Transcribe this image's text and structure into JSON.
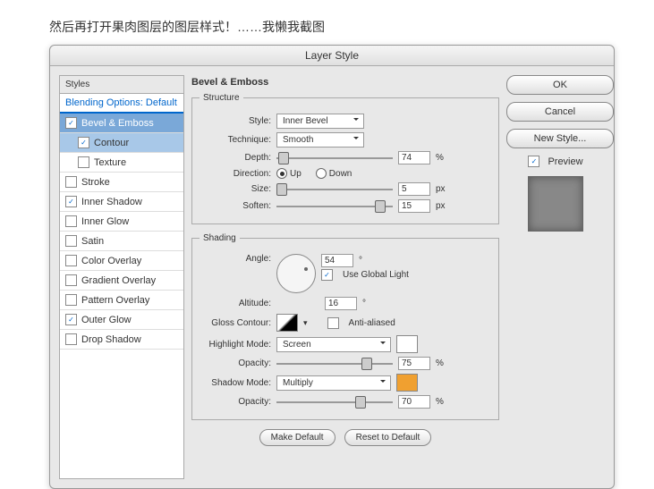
{
  "caption": "然后再打开果肉图层的图层样式！……我懒我截图",
  "title": "Layer Style",
  "leftHeader": "Styles",
  "effects": {
    "blending": "Blending Options: Default",
    "bevel": "Bevel & Emboss",
    "contour": "Contour",
    "texture": "Texture",
    "stroke": "Stroke",
    "innerShadow": "Inner Shadow",
    "innerGlow": "Inner Glow",
    "satin": "Satin",
    "colorOverlay": "Color Overlay",
    "gradientOverlay": "Gradient Overlay",
    "patternOverlay": "Pattern Overlay",
    "outerGlow": "Outer Glow",
    "dropShadow": "Drop Shadow"
  },
  "panel": {
    "title": "Bevel & Emboss",
    "structure": {
      "legend": "Structure",
      "styleLbl": "Style:",
      "styleVal": "Inner Bevel",
      "techLbl": "Technique:",
      "techVal": "Smooth",
      "depthLbl": "Depth:",
      "depthVal": "74",
      "depthUnit": "%",
      "dirLbl": "Direction:",
      "dirUp": "Up",
      "dirDown": "Down",
      "sizeLbl": "Size:",
      "sizeVal": "5",
      "sizeUnit": "px",
      "softenLbl": "Soften:",
      "softenVal": "15",
      "softenUnit": "px"
    },
    "shading": {
      "legend": "Shading",
      "angleLbl": "Angle:",
      "angleVal": "54",
      "angleUnit": "°",
      "globalLight": "Use Global Light",
      "altLbl": "Altitude:",
      "altVal": "16",
      "altUnit": "°",
      "glossLbl": "Gloss Contour:",
      "antiAlias": "Anti-aliased",
      "hlLbl": "Highlight Mode:",
      "hlVal": "Screen",
      "hlOpLbl": "Opacity:",
      "hlOpVal": "75",
      "hlOpUnit": "%",
      "shLbl": "Shadow Mode:",
      "shVal": "Multiply",
      "shOpLbl": "Opacity:",
      "shOpVal": "70",
      "shOpUnit": "%"
    },
    "makeDefault": "Make Default",
    "resetDefault": "Reset to Default"
  },
  "right": {
    "ok": "OK",
    "cancel": "Cancel",
    "newStyle": "New Style...",
    "preview": "Preview"
  }
}
